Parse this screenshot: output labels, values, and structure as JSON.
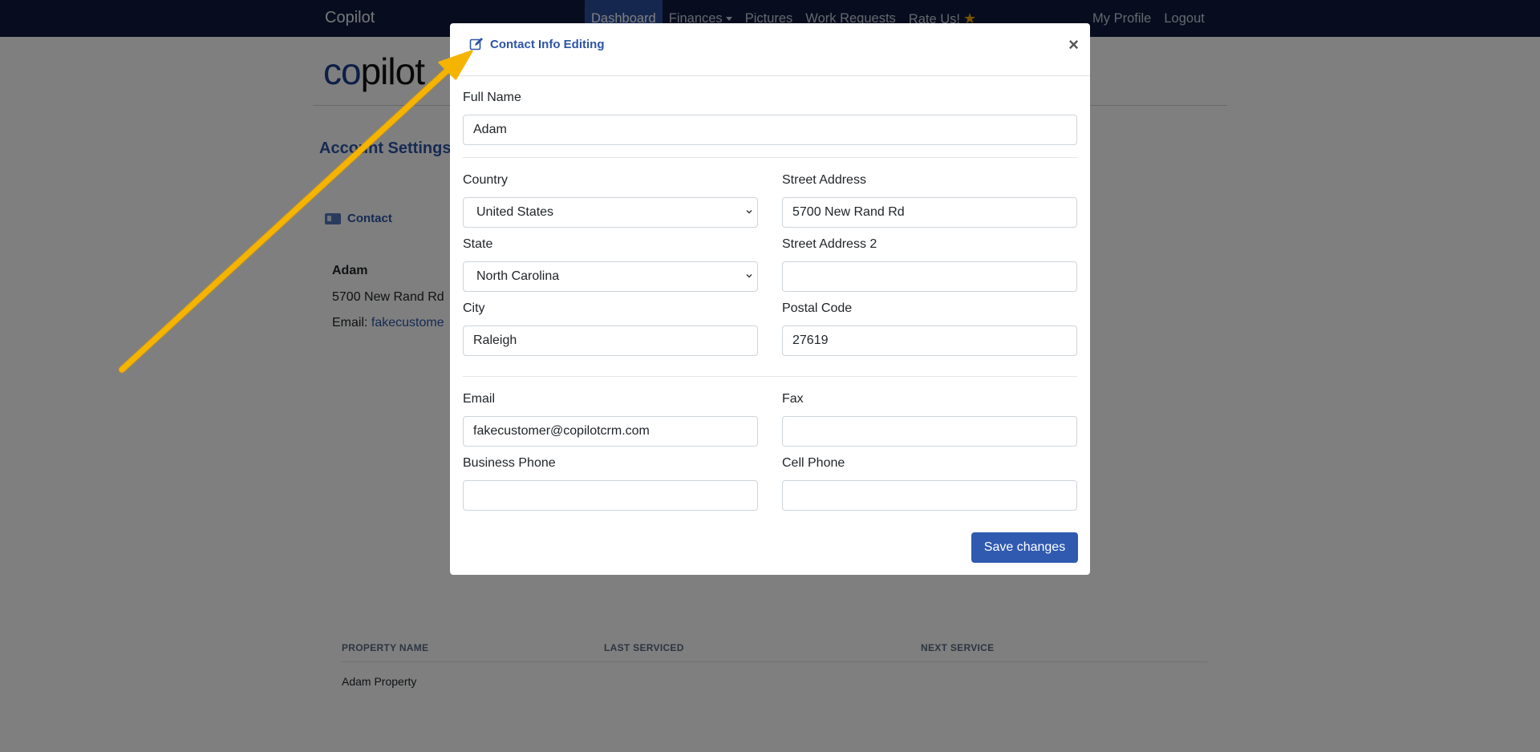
{
  "navbar": {
    "brand": "Copilot",
    "items": [
      "Dashboard",
      "Finances",
      "Pictures",
      "Work Requests",
      "Rate Us!"
    ],
    "right_items": [
      "My Profile",
      "Logout"
    ]
  },
  "page": {
    "logo_co": "co",
    "logo_rest": "pilot",
    "title": "Account Settings /",
    "contact_tab": "Contact",
    "contact_card": {
      "name": "Adam",
      "address": "5700 New Rand Rd",
      "email_label": "Email: ",
      "email_partial": "fakecustome"
    },
    "properties_table": {
      "headers": [
        "PROPERTY NAME",
        "LAST SERVICED",
        "NEXT SERVICE"
      ],
      "rows": [
        [
          "Adam Property",
          "",
          ""
        ]
      ]
    }
  },
  "modal": {
    "title": "Contact Info Editing",
    "close_glyph": "×",
    "fields": {
      "full_name": {
        "label": "Full Name",
        "value": "Adam"
      },
      "country": {
        "label": "Country",
        "value": "United States"
      },
      "street_address": {
        "label": "Street Address",
        "value": "5700 New Rand Rd"
      },
      "state": {
        "label": "State",
        "value": "North Carolina"
      },
      "street_address_2": {
        "label": "Street Address 2",
        "value": ""
      },
      "city": {
        "label": "City",
        "value": "Raleigh"
      },
      "postal_code": {
        "label": "Postal Code",
        "value": "27619"
      },
      "email": {
        "label": "Email",
        "value": "fakecustomer@copilotcrm.com"
      },
      "fax": {
        "label": "Fax",
        "value": ""
      },
      "business_phone": {
        "label": "Business Phone",
        "value": ""
      },
      "cell_phone": {
        "label": "Cell Phone",
        "value": ""
      }
    },
    "save_label": "Save changes"
  },
  "colors": {
    "navbar_bg": "#0f1b3d",
    "nav_active": "#2c4f9e",
    "accent": "#2c54a6",
    "primary_button": "#2f5ab0",
    "annotation_arrow": "#f5b400"
  },
  "icons": [
    "edit-icon",
    "id-card-icon",
    "star-icon",
    "close-icon",
    "chevron-down-icon",
    "caret-down-icon"
  ]
}
